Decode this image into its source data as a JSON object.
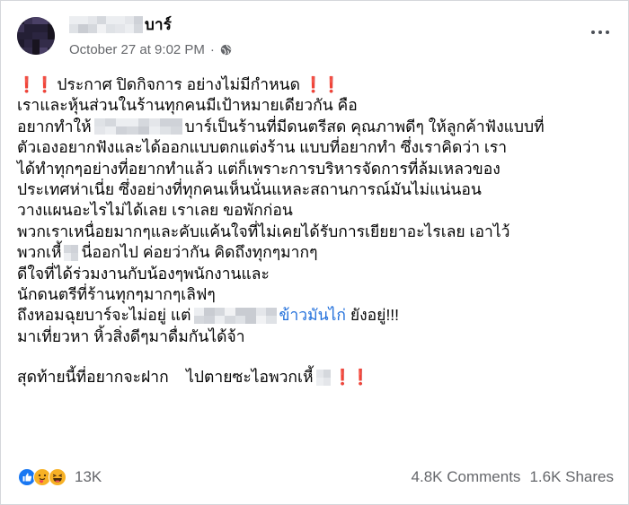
{
  "header": {
    "name_suffix": "บาร์",
    "timestamp": "October 27 at 9:02 PM",
    "separator": "·",
    "privacy_icon": "globe-icon",
    "more_icon": "more-options-icon"
  },
  "post": {
    "lines": [
      {
        "text": "ประกาศ ปิดกิจการ อย่างไม่มีกำหนด"
      },
      {
        "text": "เราและหุ้นส่วนในร้านทุกคนมีเป้าหมายเดียวกัน คือ"
      },
      {
        "pre": "อยากทำให้",
        "post": "บาร์เป็นร้านที่มีดนตรีสด คุณภาพดีๆ ให้ลูกค้าฟังแบบที่"
      },
      {
        "text": "ตัวเองอยากฟังและได้ออกแบบตกแต่งร้าน แบบที่อยากทำ ซึ่งเราคิดว่า เรา"
      },
      {
        "text": "ได้ทำทุกๆอย่างที่อยากทำแล้ว แต่ก็เพราะการบริหารจัดการที่ล้มเหลวของ"
      },
      {
        "text": "ประเทศห่าเนี่ย ซึ่งอย่างที่ทุกคนเห็นนั่นแหละสถานการณ์มันไม่แน่นอน"
      },
      {
        "text": "วางแผนอะไรไม่ได้เลย เราเลย ขอพักก่อน"
      },
      {
        "text": "พวกเราเหนื่อยมากๆและคับแค้นใจที่ไม่เคยได้รับการเยียยาอะไรเลย เอาไว้"
      },
      {
        "pre": "พวกเหี้",
        "post": "นี่ออกไป ค่อยว่ากัน คิดถึงทุกๆมากๆ"
      },
      {
        "text": "ดีใจที่ได้ร่วมงานกับน้องๆพนักงานและ"
      },
      {
        "text": "นักดนตรีที่ร้านทุกๆมากๆเลิฟๆ"
      },
      {
        "pre": "ถึงหอมฉุยบาร์จะไม่อยู่ แต่",
        "link": "ข้าวมันไก่",
        "post": " ยังอยู่!!!"
      },
      {
        "text": "มาเที่ยวหา หิ้วสิ่งดีๆมาดื่มกันได้จ้า"
      },
      {
        "text": "สุดท้ายนี้ที่อยากจะฝาก    ไปตายซะไอพวกเหี้"
      }
    ],
    "bang": "❗❗"
  },
  "footer": {
    "reaction_icons": [
      "like-icon",
      "care-icon",
      "haha-icon"
    ],
    "reaction_count": "13K",
    "comments": "4.8K Comments",
    "shares": "1.6K Shares"
  },
  "colors": {
    "link": "#216fdb",
    "bang": "#e2262c",
    "secondary_text": "#65676b",
    "like_blue": "#1877f2",
    "reaction_yellow": "#f7b125"
  }
}
